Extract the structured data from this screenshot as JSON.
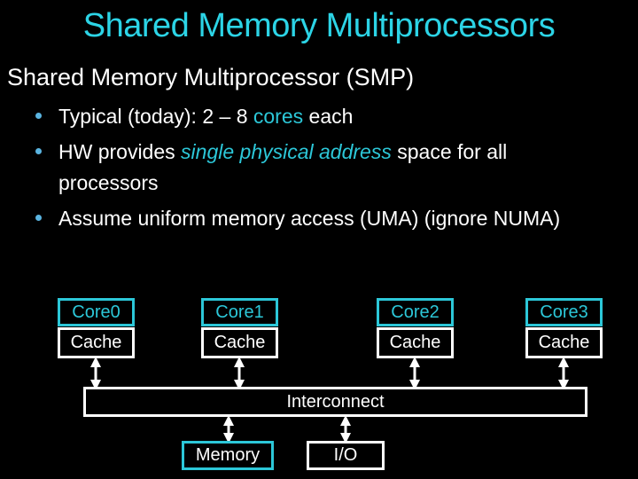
{
  "slide": {
    "title": "Shared Memory Multiprocessors",
    "heading": "Shared Memory Multiprocessor (SMP)",
    "bullets": [
      {
        "pre": "Typical (today): 2 – 8 ",
        "em": "cores",
        "post": " each"
      },
      {
        "pre": "HW provides ",
        "em": "single physical address",
        "post": " space for all",
        "cont": "processors"
      },
      {
        "pre": "Assume uniform memory access (UMA) (ignore NUMA)"
      }
    ]
  },
  "diagram": {
    "cores": [
      {
        "core": "Core0",
        "cache": "Cache"
      },
      {
        "core": "Core1",
        "cache": "Cache"
      },
      {
        "core": "Core2",
        "cache": "Cache"
      },
      {
        "core": "Core3",
        "cache": "Cache"
      }
    ],
    "interconnect": "Interconnect",
    "memory": "Memory",
    "io": "I/O"
  },
  "colors": {
    "accent": "#2cc7d8",
    "title": "#2cd4e6",
    "bullet": "#5ab4e0",
    "background": "#000000",
    "foreground": "#ffffff"
  }
}
